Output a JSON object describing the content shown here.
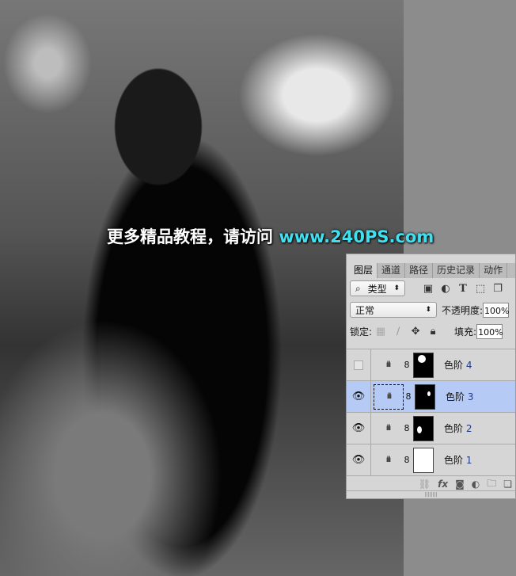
{
  "watermark": {
    "text": "更多精品教程，请访问 ",
    "url": "www.240PS.com"
  },
  "panel": {
    "tabs": [
      "图层",
      "通道",
      "路径",
      "历史记录",
      "动作"
    ],
    "filter": {
      "label": "类型",
      "icons": [
        "image-filter-icon",
        "adjustment-filter-icon",
        "type-filter-icon",
        "shape-filter-icon",
        "smart-object-filter-icon"
      ]
    },
    "blend_mode": "正常",
    "opacity_label": "不透明度:",
    "opacity": "100%",
    "lock_label": "锁定:",
    "fill_label": "填充:",
    "fill": "100%",
    "layers": [
      {
        "name": "色阶",
        "num": "4",
        "visible": false,
        "selected": false
      },
      {
        "name": "色阶",
        "num": "3",
        "visible": true,
        "selected": true
      },
      {
        "name": "色阶",
        "num": "2",
        "visible": true,
        "selected": false
      },
      {
        "name": "色阶",
        "num": "1",
        "visible": true,
        "selected": false
      }
    ],
    "bottom_icons": [
      "link-icon",
      "fx-icon",
      "mask-icon",
      "adjustment-icon",
      "folder-icon",
      "new-layer-icon"
    ],
    "colors": {
      "selected": "#b5cbf5",
      "url": "#3fe0f0"
    }
  }
}
